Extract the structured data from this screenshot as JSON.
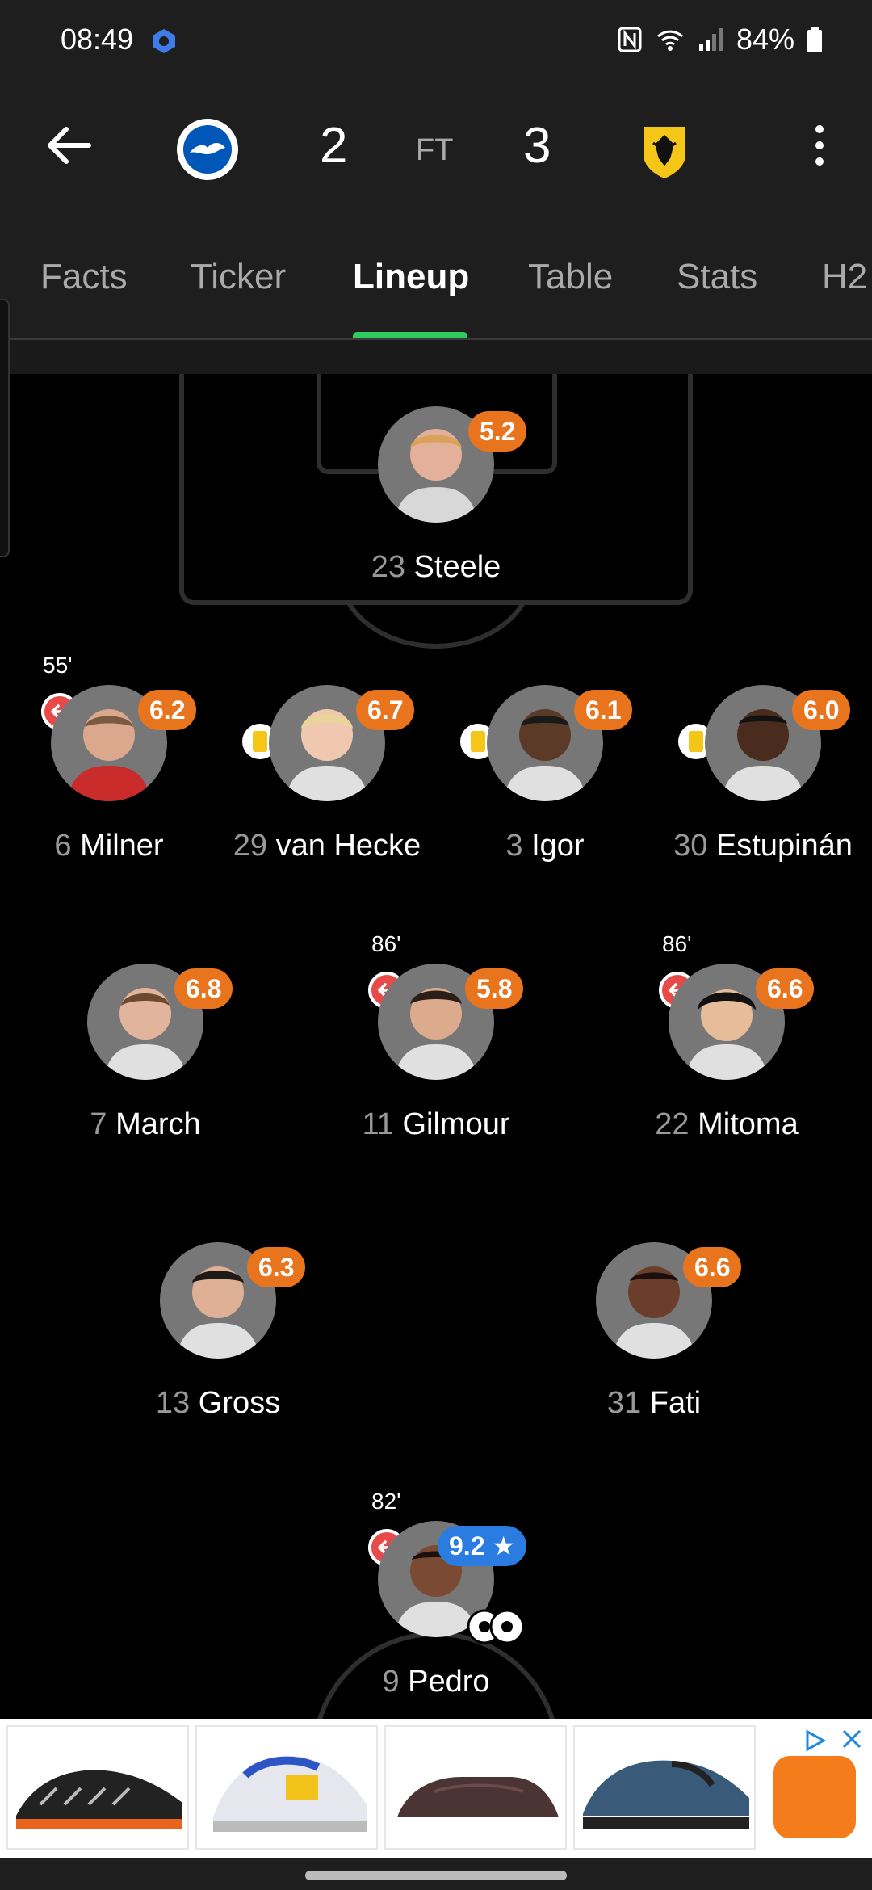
{
  "status_bar": {
    "time": "08:49",
    "battery": "84%"
  },
  "match": {
    "home_score": "2",
    "status": "FT",
    "away_score": "3"
  },
  "tabs": [
    {
      "label": "Facts"
    },
    {
      "label": "Ticker"
    },
    {
      "label": "Lineup"
    },
    {
      "label": "Table"
    },
    {
      "label": "Stats"
    },
    {
      "label": "H2"
    }
  ],
  "players": {
    "steele": {
      "number": "23",
      "name": "Steele",
      "rating": "5.2"
    },
    "milner": {
      "number": "6",
      "name": "Milner",
      "rating": "6.2",
      "sub_minute": "55'"
    },
    "vanhecke": {
      "number": "29",
      "name": "van Hecke",
      "rating": "6.7"
    },
    "igor": {
      "number": "3",
      "name": "Igor",
      "rating": "6.1"
    },
    "estupinan": {
      "number": "30",
      "name": "Estupinán",
      "rating": "6.0"
    },
    "march": {
      "number": "7",
      "name": "March",
      "rating": "6.8"
    },
    "gilmour": {
      "number": "11",
      "name": "Gilmour",
      "rating": "5.8",
      "sub_minute": "86'"
    },
    "mitoma": {
      "number": "22",
      "name": "Mitoma",
      "rating": "6.6",
      "sub_minute": "86'"
    },
    "gross": {
      "number": "13",
      "name": "Gross",
      "rating": "6.3"
    },
    "fati": {
      "number": "31",
      "name": "Fati",
      "rating": "6.6"
    },
    "pedro": {
      "number": "9",
      "name": "Pedro",
      "rating": "9.2 ★",
      "sub_minute": "82'"
    }
  },
  "colors": {
    "rating": "#e8741d",
    "top_rating": "#2a7ce0",
    "active_tab_indicator": "#2ecc5e",
    "sub_off": "#e84a4a",
    "yellow_card": "#f5c518"
  }
}
